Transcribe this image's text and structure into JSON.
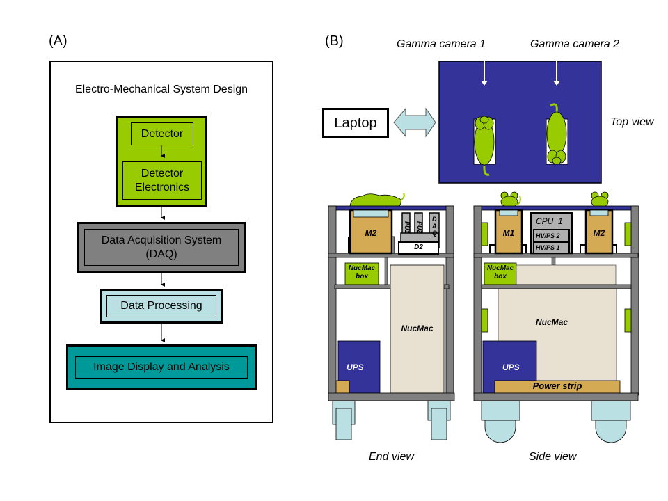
{
  "panel_a": {
    "label": "(A)",
    "title": "Electro-Mechanical System Design",
    "blocks": [
      {
        "id": "detector",
        "lines": [
          "Detector"
        ],
        "color": "#99cc00"
      },
      {
        "id": "detector-electronics",
        "lines": [
          "Detector",
          "Electronics"
        ],
        "color": "#99cc00"
      },
      {
        "id": "daq",
        "lines": [
          "Data Acquisition System",
          "(DAQ)"
        ],
        "color": "#808080"
      },
      {
        "id": "data-processing",
        "lines": [
          "Data Processing"
        ],
        "color": "#bbe0e3"
      },
      {
        "id": "image-display",
        "lines": [
          "Image Display and Analysis"
        ],
        "color": "#009999"
      }
    ]
  },
  "panel_b": {
    "label": "(B)",
    "laptop": "Laptop",
    "gamma_camera_1": "Gamma camera 1",
    "gamma_camera_2": "Gamma camera 2",
    "top_view": "Top view",
    "end_view": "End view",
    "side_view": "Side view",
    "end": {
      "m2": "M2",
      "pu1": "PU1",
      "pu2": "PU2",
      "daq": "DAQ",
      "d2": "D2",
      "nucmac_box": [
        "NucMac",
        "box"
      ],
      "nucmac": "NucMac",
      "ups": "UPS"
    },
    "side": {
      "m1": "M1",
      "m2": "M2",
      "cpu": "CPU  1",
      "hvps2": "HV/PS 2",
      "hvps1": "HV/PS 1",
      "nucmac_box": [
        "NucMac",
        "box"
      ],
      "nucmac": "NucMac",
      "ups": "UPS",
      "power_strip": "Power strip"
    },
    "colors": {
      "blue": "#333399",
      "green": "#99cc00",
      "tan": "#d4aa55",
      "frame": "#808080",
      "light_blue": "#bbe0e3",
      "beige": "#e8e0d0"
    }
  }
}
